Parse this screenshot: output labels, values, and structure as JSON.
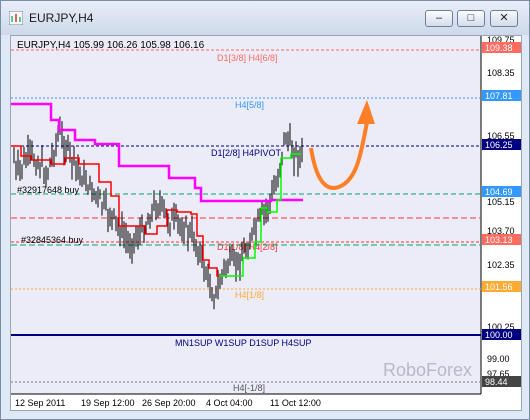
{
  "window": {
    "title": "EURJPY,H4",
    "buttons": {
      "minimize": "–",
      "maximize": "□",
      "close": "✕"
    }
  },
  "chart": {
    "header": "EURJPY,H4  105.99 106.26 105.98 106.16",
    "watermark": "RoboForex",
    "colors": {
      "background": "#ecebf8",
      "candle": "#000000",
      "red_line": "#ff0000",
      "magenta_line": "#ff00ff",
      "green_line": "#00ff00",
      "arrow": "#ff7f27"
    },
    "price_axis_labels": [
      "109.75",
      "108.35",
      "106.55",
      "105.15",
      "103.70",
      "102.35",
      "100.25",
      "99.00",
      "97.65"
    ],
    "time_axis_labels": [
      "12 Sep 2011",
      "19 Sep 12:00",
      "26 Sep 20:00",
      "4 Oct 04:00",
      "11 Oct 12:00"
    ],
    "levels": [
      {
        "label": "D1[3/8] H4[6/8]",
        "price_tag": "109.38",
        "color": "#ff6b5e",
        "text_color": "#ff6b5e"
      },
      {
        "label": "H4[5/8]",
        "price_tag": "107.81",
        "color": "#3399ff",
        "text_color": "#3399ff"
      },
      {
        "label": "D1[2/8] H4PIVOT",
        "price_tag": "106.25",
        "color": "#000080",
        "text_color": "#000080"
      },
      {
        "label": "",
        "price_tag": "104.69",
        "color": "#00aa66",
        "text_color": "#00aa66"
      },
      {
        "label": "D1[1/8] H4[2/8]",
        "price_tag": "103.13",
        "color": "#ff3333",
        "text_color": "#ff3333"
      },
      {
        "label": "H4[1/8]",
        "price_tag": "101.56",
        "color": "#ffaa33",
        "text_color": "#ffaa33"
      },
      {
        "label": "MN1SUP W1SUP D1SUP H4SUP",
        "price_tag": "100.00",
        "color": "#000080",
        "text_color": "#000080"
      },
      {
        "label": "H4[-1/8]",
        "price_tag": "98.44",
        "color": "#555555",
        "text_color": "#555555"
      }
    ],
    "current_price_tag": "106.25",
    "annotations": [
      {
        "label": "#32917648 buy"
      },
      {
        "label": "#32845364 buy"
      }
    ]
  }
}
